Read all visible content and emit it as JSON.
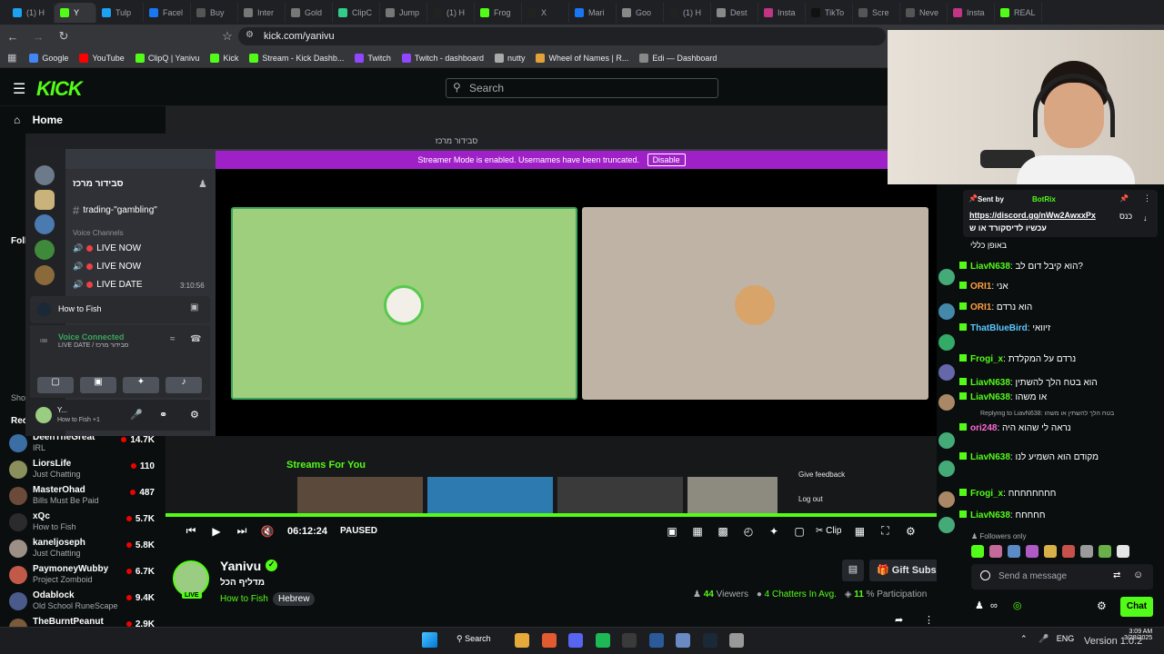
{
  "browser": {
    "tabs": [
      "(1) H",
      "Y",
      "Tulp",
      "Facel",
      "Buy",
      "Inter",
      "Gold",
      "ClipC",
      "Jump",
      "(1) H",
      "Frog",
      "X",
      "Mari",
      "Goo",
      "(1) H",
      "Dest",
      "Insta",
      "TikTo",
      "Scre",
      "Neve",
      "Insta",
      "REAL"
    ],
    "url": "kick.com/yanivu",
    "bookmarks": [
      "Google",
      "YouTube",
      "ClipQ | Yanivu",
      "Kick",
      "Stream - Kick Dashb...",
      "Twitch",
      "Twitch - dashboard",
      "nutty",
      "Wheel of Names | R...",
      "Edi — Dashboard"
    ]
  },
  "kick": {
    "logo": "KICK",
    "search_placeholder": "Search",
    "sidebar": {
      "home": "Home",
      "following_label": "Foll",
      "shows_label": "Sho",
      "recommended_label": "Rec",
      "channels": [
        {
          "name": "DeenTheGreat",
          "game": "IRL",
          "viewers": "14.7K",
          "color": "#3a6ea5"
        },
        {
          "name": "LiorsLife",
          "game": "Just Chatting",
          "viewers": "110",
          "color": "#8a8f5c"
        },
        {
          "name": "MasterOhad",
          "game": "Bills Must Be Paid",
          "viewers": "487",
          "color": "#6b4a3a"
        },
        {
          "name": "xQc",
          "game": "How to Fish",
          "viewers": "5.7K",
          "color": "#2b2b2b"
        },
        {
          "name": "kaneljoseph",
          "game": "Just Chatting",
          "viewers": "5.8K",
          "color": "#9c8f86"
        },
        {
          "name": "PaymoneyWubby",
          "game": "Project Zomboid",
          "viewers": "6.7K",
          "color": "#c25a4a"
        },
        {
          "name": "Odablock",
          "game": "Old School RuneScape",
          "viewers": "9.4K",
          "color": "#4a5a8a"
        },
        {
          "name": "TheBurntPeanut",
          "game": "",
          "viewers": "2.9K",
          "color": "#7a5a3a"
        }
      ]
    },
    "discord": {
      "window_title": "סבידור מרכז",
      "streamer_mode": "Streamer Mode is enabled. Usernames have been truncated.",
      "disable_label": "Disable",
      "server_name": "סבידור מרכז",
      "text_channel": "trading-\"gambling\"",
      "voice_header": "Voice Channels",
      "voice_channels": [
        "LIVE NOW",
        "LIVE NOW",
        "LIVE DATE"
      ],
      "timer": "3:10:56",
      "activity": "How to Fish",
      "voice_connected": "Voice Connected",
      "voice_sub": "LIVE DATE / סבידור מרכז",
      "user_name": "Y...",
      "user_status": "How to Fish +1"
    },
    "below_player": {
      "streams_for_you": "Streams For You",
      "give_feedback": "Give feedback",
      "log_out": "Log out"
    },
    "player": {
      "time": "06:12:24",
      "state": "PAUSED",
      "clip_label": "Clip"
    },
    "stream": {
      "streamer": "Yanivu",
      "title": "מדליף הכל",
      "game": "How to Fish",
      "language": "Hebrew",
      "live_badge": "LIVE",
      "viewers": "44",
      "viewers_label": "Viewers",
      "chatters": "4 Chatters In Avg.",
      "participation": "11",
      "participation_label": "% Participation",
      "gift_subs": "Gift Subs"
    },
    "chat": {
      "pinned_by": "Sent by",
      "pinned_user": "BotRix",
      "pinned_link": "https://discord.gg/nWw2AwxxPx",
      "pinned_suffix": "כנס",
      "pinned_text": "עכשיו לדיסקורד או ש",
      "pinned_text2": "באופן כללי",
      "messages": [
        {
          "user": "LiavN638",
          "text": "הוא קיבל דום לב?"
        },
        {
          "user": "ORI1",
          "text": "אני"
        },
        {
          "user": "ORI1",
          "text": "הוא נרדם"
        },
        {
          "user": "ThatBlueBird",
          "text": "זיוואי"
        },
        {
          "user": "Frogi_x",
          "text": "נרדם על המקלדת"
        },
        {
          "user": "LiavN638",
          "text": "הוא בטח הלך להשתין"
        },
        {
          "user": "LiavN638",
          "text": "או משהו"
        },
        {
          "user": "ori248",
          "text": "נראה לי שהוא היה"
        },
        {
          "user": "LiavN638",
          "text": "מקודם הוא השמיע לנו"
        },
        {
          "user": "Frogi_x",
          "text": "חחחחחחחח"
        },
        {
          "user": "LiavN638",
          "text": "חחחחח"
        }
      ],
      "reply_to": "Replying to LiavN638: בטח הלך להשתין או משהו",
      "followers_only": "Followers only",
      "send_placeholder": "Send a message",
      "chat_button": "Chat"
    }
  },
  "taskbar": {
    "search": "Search",
    "lang": "ENG",
    "clock_time": "3:09 AM",
    "clock_date": "3/28/2025",
    "version": "Version 1.0.2"
  }
}
